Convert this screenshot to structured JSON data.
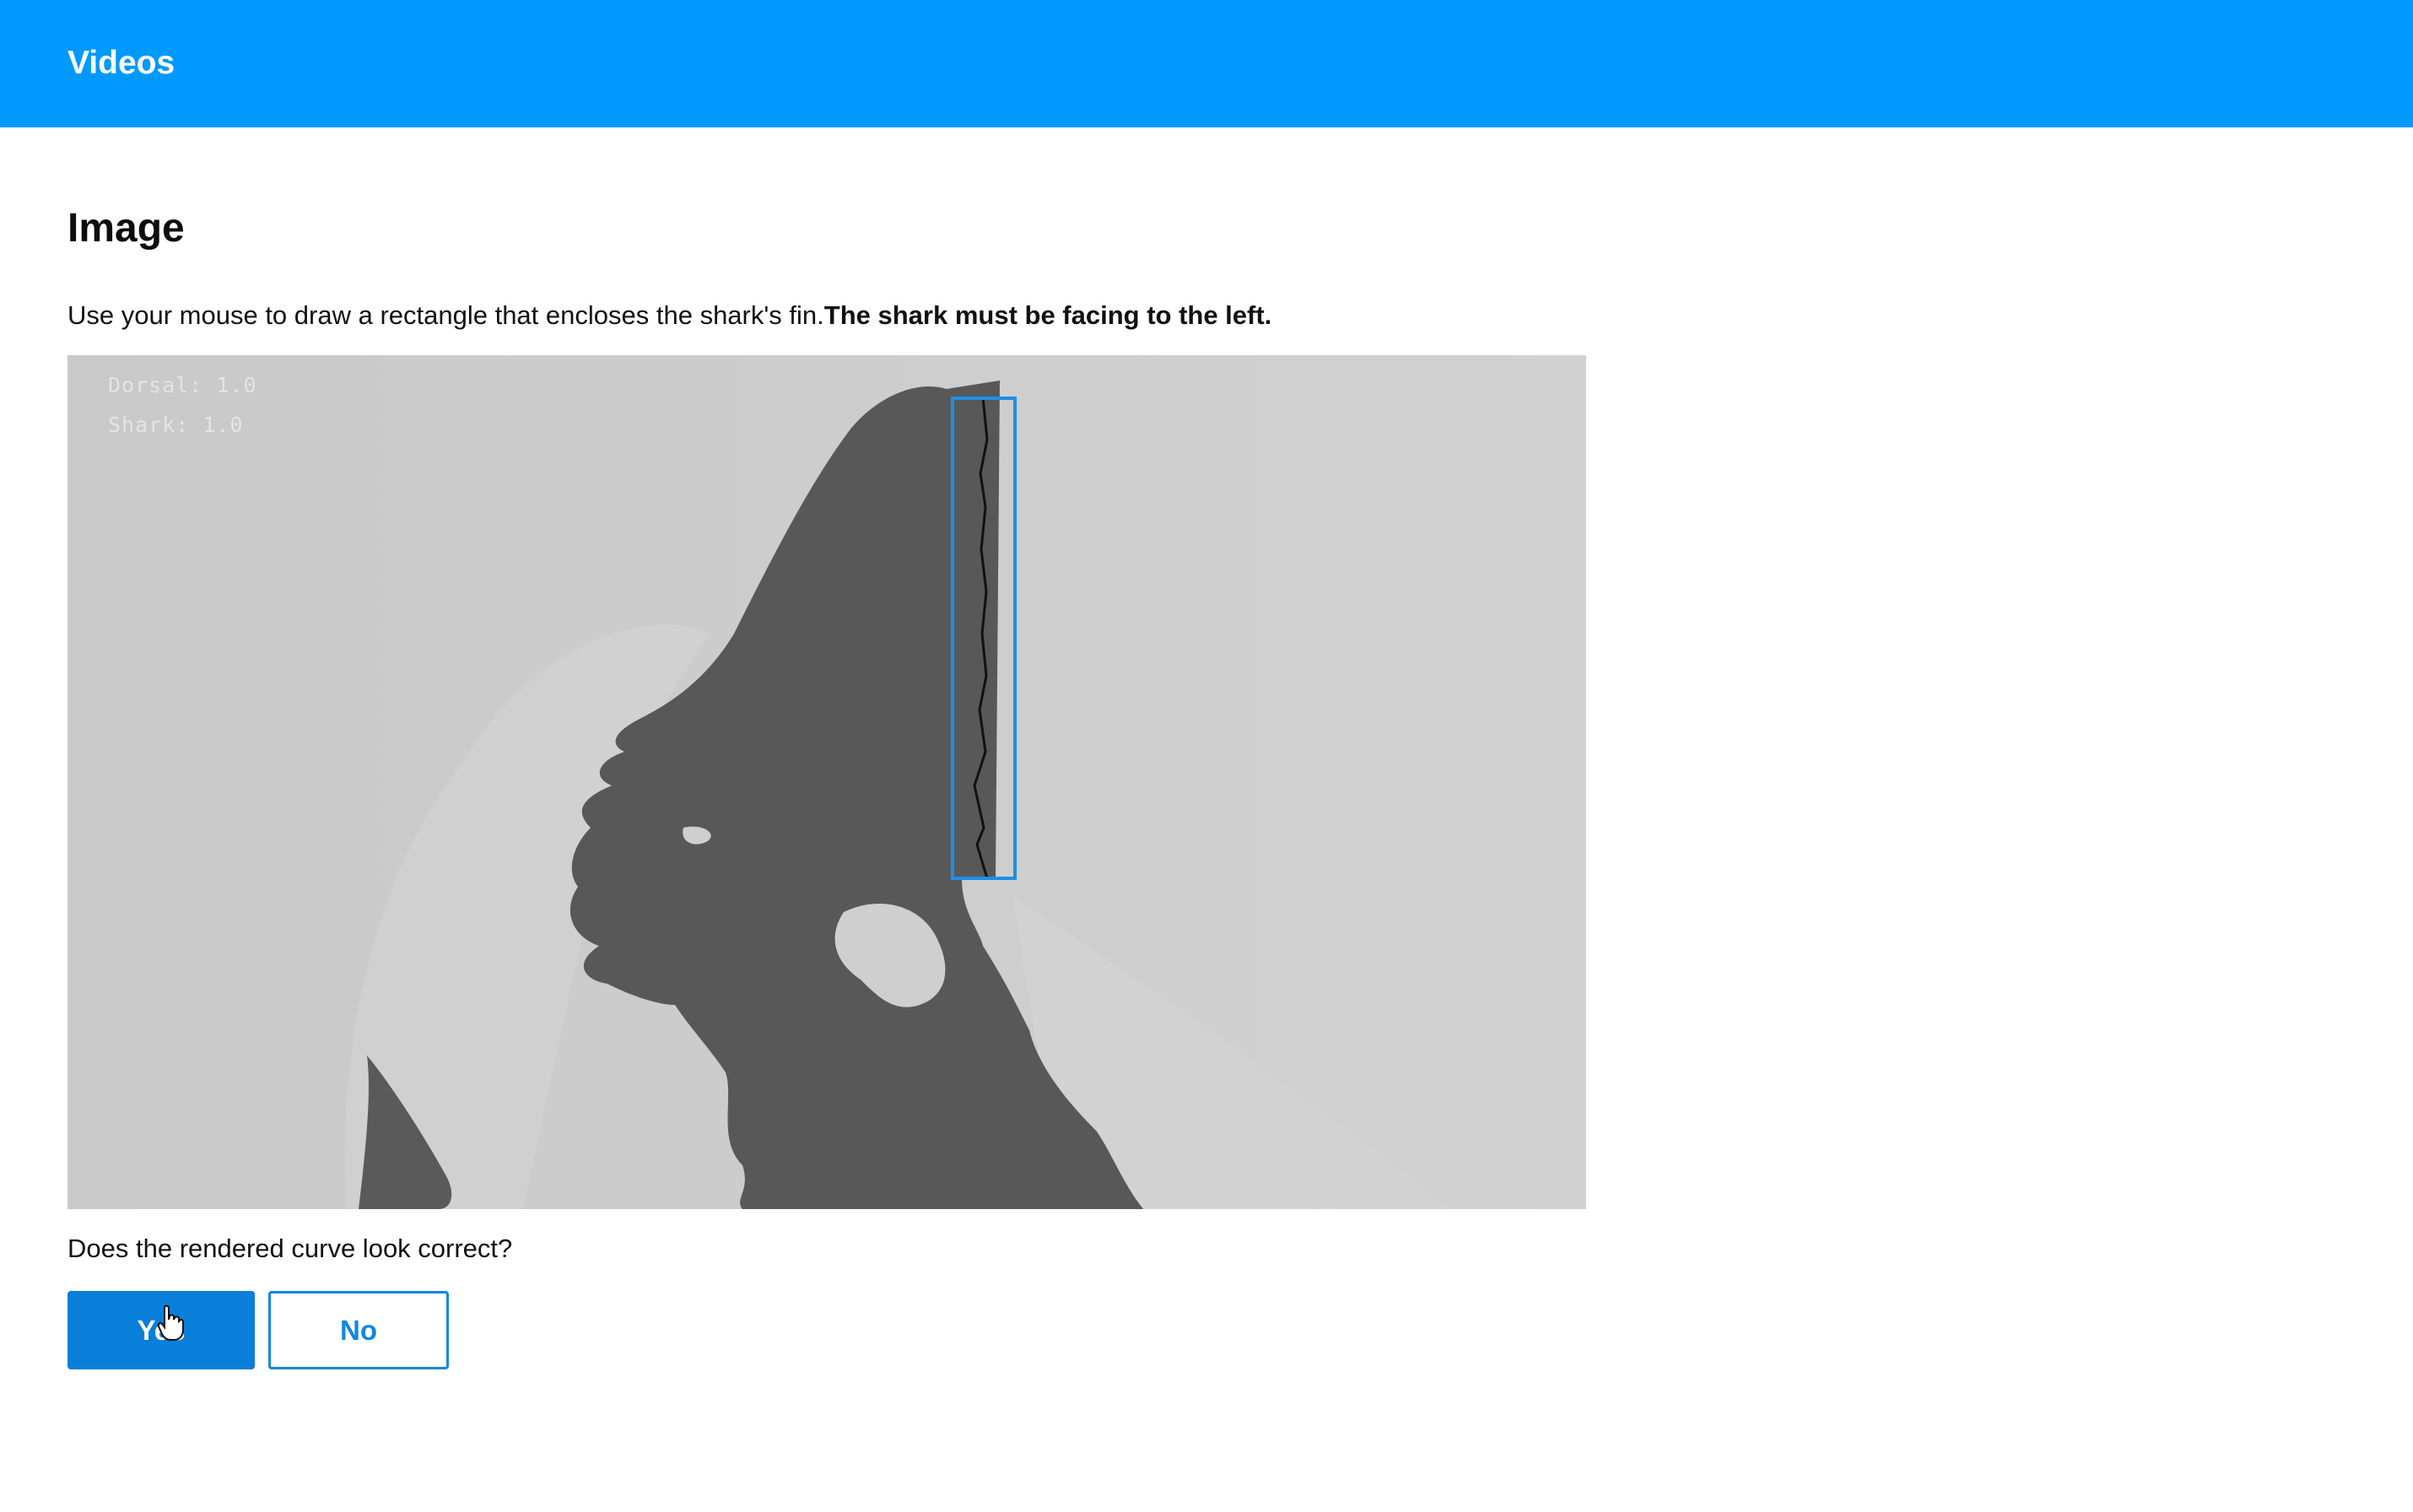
{
  "header": {
    "title": "Videos"
  },
  "main": {
    "heading": "Image",
    "instruction_text": "Use your mouse to draw a rectangle that encloses the shark's fin.",
    "instruction_bold": "The shark must be facing to the left.",
    "image": {
      "overlay_line1": "Dorsal: 1.0",
      "overlay_line2": "Shark: 1.0"
    },
    "question": "Does the rendered curve look correct?",
    "yes_label": "Yes",
    "no_label": "No"
  },
  "colors": {
    "header_bg": "#0099ff",
    "primary_button": "#0a7fd9",
    "selection_box": "#1e8fe6"
  },
  "icons": [
    "hand-pointer-cursor-icon"
  ]
}
